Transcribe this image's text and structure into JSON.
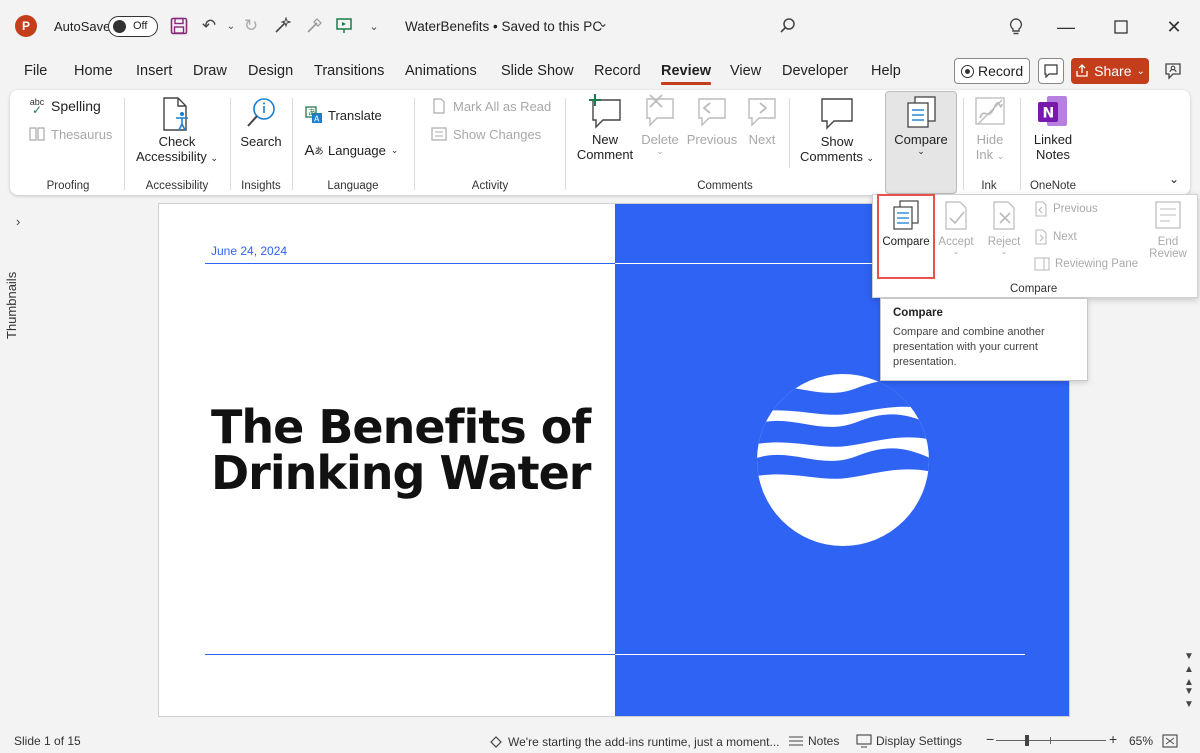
{
  "window": {
    "autosave_label": "AutoSave",
    "autosave_state": "Off",
    "doc_title": "WaterBenefits • Saved to this PC",
    "app_letter": "P"
  },
  "tabs": [
    "File",
    "Home",
    "Insert",
    "Draw",
    "Design",
    "Transitions",
    "Animations",
    "Slide Show",
    "Record",
    "Review",
    "View",
    "Developer",
    "Help"
  ],
  "active_tab": "Review",
  "header_buttons": {
    "record": "Record",
    "share": "Share"
  },
  "ribbon": {
    "proofing": {
      "spelling": "Spelling",
      "thesaurus": "Thesaurus",
      "label": "Proofing"
    },
    "accessibility": {
      "line1": "Check",
      "line2": "Accessibility",
      "label": "Accessibility"
    },
    "insights": {
      "search": "Search",
      "label": "Insights"
    },
    "language": {
      "translate": "Translate",
      "language": "Language",
      "label": "Language"
    },
    "activity": {
      "mark_all": "Mark All as Read",
      "show_changes": "Show Changes",
      "label": "Activity"
    },
    "comments": {
      "new_line1": "New",
      "new_line2": "Comment",
      "delete": "Delete",
      "previous": "Previous",
      "next": "Next",
      "show_line1": "Show",
      "show_line2": "Comments",
      "label": "Comments"
    },
    "compare": {
      "label": "Compare"
    },
    "ink": {
      "line1": "Hide",
      "line2": "Ink",
      "label": "Ink"
    },
    "onenote": {
      "line1": "Linked",
      "line2": "Notes",
      "label": "OneNote"
    }
  },
  "thumbnails_label": "Thumbnails",
  "slide": {
    "date": "June 24, 2024",
    "title_line1": "The Benefits of",
    "title_line2": "Drinking Water"
  },
  "compare_panel": {
    "compare": "Compare",
    "accept": "Accept",
    "reject": "Reject",
    "previous": "Previous",
    "next": "Next",
    "reviewing_pane": "Reviewing Pane",
    "end_line1": "End",
    "end_line2": "Review",
    "group_label": "Compare"
  },
  "tooltip": {
    "title": "Compare",
    "body": "Compare and combine another presentation with your current presentation."
  },
  "status": {
    "slide": "Slide 1 of 15",
    "addins": "We're starting the add-ins runtime, just a moment...",
    "notes": "Notes",
    "display": "Display Settings",
    "zoom": "65%"
  },
  "colors": {
    "accent": "#c43e1c",
    "slide_blue": "#2f63f4",
    "highlight": "#e8524a"
  }
}
